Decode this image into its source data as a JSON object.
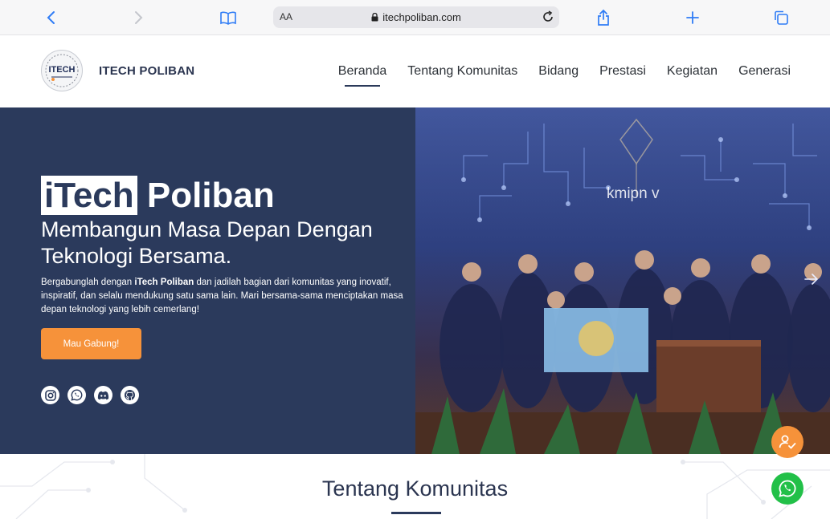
{
  "browser": {
    "url_text": "itechpoliban.com",
    "reader_label": "AA",
    "icons": [
      "chevron-left-icon",
      "chevron-right-icon",
      "book-icon",
      "lock-icon",
      "reload-icon",
      "share-icon",
      "plus-icon",
      "tabs-icon"
    ]
  },
  "header": {
    "logo_text": "ITECH",
    "brand_name": "ITECH POLIBAN",
    "nav": [
      {
        "label": "Beranda",
        "active": true
      },
      {
        "label": "Tentang Komunitas"
      },
      {
        "label": "Bidang"
      },
      {
        "label": "Prestasi"
      },
      {
        "label": "Kegiatan"
      },
      {
        "label": "Generasi"
      }
    ]
  },
  "hero": {
    "title_highlight": "iTech",
    "title_rest": " Poliban",
    "subtitle": "Membangun Masa Depan Dengan Teknologi Bersama.",
    "desc_before": "Bergabunglah dengan ",
    "desc_bold": "iTech Poliban",
    "desc_after": " dan jadilah bagian dari komunitas yang inovatif, inspiratif, dan selalu mendukung satu sama lain. Mari bersama-sama menciptakan masa depan teknologi yang lebih cemerlang!",
    "cta_label": "Mau Gabung!",
    "socials": [
      "instagram-icon",
      "whatsapp-icon",
      "discord-icon",
      "github-icon"
    ],
    "photo_text": "kmipn v"
  },
  "section": {
    "title": "Tentang Komunitas"
  },
  "colors": {
    "navy": "#2b3a5c",
    "orange": "#f6923a",
    "whatsapp_green": "#22c048",
    "safari_blue": "#2f7cf6"
  }
}
